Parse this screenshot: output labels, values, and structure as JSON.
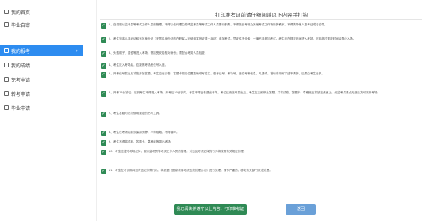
{
  "sidebar": {
    "items": [
      {
        "label": "我的首页",
        "active": false,
        "arrow": ""
      },
      {
        "label": "毕业自审",
        "active": false,
        "arrow": ""
      },
      {
        "label": "我的报考",
        "active": true,
        "arrow": "›"
      },
      {
        "label": "我的成绩",
        "active": false,
        "arrow": ""
      },
      {
        "label": "免考申请",
        "active": false,
        "arrow": ""
      },
      {
        "label": "转考申请",
        "active": false,
        "arrow": ""
      },
      {
        "label": "毕业申请",
        "active": false,
        "arrow": ""
      }
    ]
  },
  "main": {
    "title": "打印准考证前请仔细阅读以下内容并打钩",
    "items": [
      "1、自觉服从监考员等考试工作人员的管理，不得以任何理由妨碍监考员等考试工作人员履行职责，不得扰乱考场及其他考试工作场所的秩序。不得携带他人准考证或者自带。",
      "2、考生须本人准考证和有效身份证（无居民身份证的在职军人可使用军官证或士兵证）参加考试。凭证件不全者，一律不准参加考试。考生应在规定时间进入考场，迟到超过规定时间者禁止入场。",
      "3、头戴帽子、墨镜等进入考场，需接受安检核对身份；须配合考务人员检查。",
      "4、考生进入考场后，应按照考场座位号入座。",
      "5、开考信号发出后才能开始答题。考生应在试卷、答题卡规定位置准确填写姓名、准考证号、考场号、座位号等信息，凡漏填、错填或书写字迹不清的，后果由考生自负。",
      "6、开考15分钟后，迟到考生不得进入考场。开考后30分钟内，考生不得交卷退出考场。考试结束信号发出后，考生应立即停止答题，并将试卷、答题卡、草稿纸反扣放在桌面上，经监考员清点无误后方可离开考场。",
      "7、考生答题时必须使用规定的书写工具。",
      "8、考生在考场内必须保持安静，不得吸烟，不得喧哗。",
      "9、考生不得将试卷、答题卡、草稿纸等带出考场。",
      "10、考生应遵守考场纪律，服从监考员等考试工作人员的管理，对违反考试纪律的行为将按照有关规定处理。",
      "11、考生在考试期间如有违纪作弊行为，将依据《国家教育考试违规处理办法》进行处理，情节严重的，移交有关部门依法处理。"
    ]
  },
  "buttons": {
    "print": "我已阅读并遵守以上内容，打印准考证",
    "back": "返回"
  }
}
